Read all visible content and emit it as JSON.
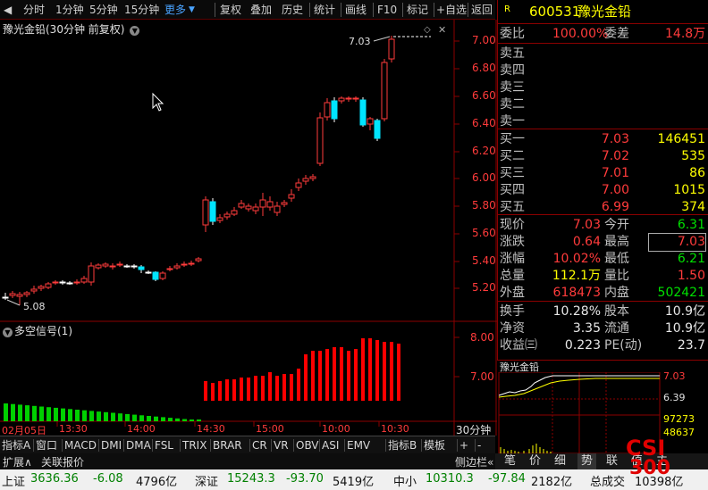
{
  "toolbar": {
    "period_tabs": [
      "分时",
      "1分钟",
      "5分钟",
      "15分钟"
    ],
    "more_label": "更多",
    "buttons": [
      "复权",
      "叠加",
      "历史",
      "统计",
      "画线",
      "F10",
      "标记",
      "+自选",
      "返回"
    ]
  },
  "chart": {
    "title": "豫光金铅(30分钟 前复权)",
    "price_axis": [
      "7.00",
      "6.80",
      "6.60",
      "6.40",
      "6.20",
      "6.00",
      "5.80",
      "5.60",
      "5.40",
      "5.20"
    ],
    "high_label": "7.03",
    "low_label": "5.08",
    "indicator_title": "多空信号(1)",
    "indicator_axis": [
      "8.00",
      "7.00"
    ],
    "time_labels": [
      "02月05日",
      "13:30",
      "14:00",
      "14:30",
      "15:00",
      "10:00",
      "10:30"
    ],
    "period_label": "30分钟"
  },
  "bottom_tabs": [
    "指标A",
    "窗口",
    "MACD",
    "DMI",
    "DMA",
    "FSL",
    "TRIX",
    "BRAR",
    "CR",
    "VR",
    "OBV",
    "ASI",
    "EMV",
    "指标B",
    "模板",
    "+",
    "-"
  ],
  "expand_bar": {
    "expand_label": "扩展∧",
    "related_label": "关联报价",
    "side_label": "侧边栏«"
  },
  "right_tabs": [
    "笔",
    "价",
    "细",
    "势",
    "联",
    "值",
    "主"
  ],
  "quote": {
    "marker": "R",
    "code": "600531",
    "name": "豫光金铅",
    "weibi_label": "委比",
    "weibi_value": "100.00%",
    "weicha_label": "委差",
    "weicha_value": "14.8万",
    "sells": [
      {
        "label": "卖五",
        "price": "",
        "vol": ""
      },
      {
        "label": "卖四",
        "price": "",
        "vol": ""
      },
      {
        "label": "卖三",
        "price": "",
        "vol": ""
      },
      {
        "label": "卖二",
        "price": "",
        "vol": ""
      },
      {
        "label": "卖一",
        "price": "",
        "vol": ""
      }
    ],
    "buys": [
      {
        "label": "买一",
        "price": "7.03",
        "vol": "146451"
      },
      {
        "label": "买二",
        "price": "7.02",
        "vol": "535"
      },
      {
        "label": "买三",
        "price": "7.01",
        "vol": "86"
      },
      {
        "label": "买四",
        "price": "7.00",
        "vol": "1015"
      },
      {
        "label": "买五",
        "price": "6.99",
        "vol": "374"
      }
    ],
    "stats": [
      {
        "l1": "现价",
        "v1": "7.03",
        "l2": "今开",
        "v2": "6.31"
      },
      {
        "l1": "涨跌",
        "v1": "0.64",
        "l2": "最高",
        "v2": "7.03"
      },
      {
        "l1": "涨幅",
        "v1": "10.02%",
        "l2": "最低",
        "v2": "6.21"
      },
      {
        "l1": "总量",
        "v1": "112.1万",
        "l2": "量比",
        "v2": "1.50"
      },
      {
        "l1": "外盘",
        "v1": "618473",
        "l2": "内盘",
        "v2": "502421"
      }
    ],
    "stats2": [
      {
        "l1": "换手",
        "v1": "10.28%",
        "l2": "股本",
        "v2": "10.9亿"
      },
      {
        "l1": "净资",
        "v1": "3.35",
        "l2": "流通",
        "v2": "10.9亿"
      },
      {
        "l1": "收益㈢",
        "v1": "0.223",
        "l2": "PE(动)",
        "v2": "23.7"
      }
    ],
    "mini_chart": {
      "name": "豫光金铅",
      "price_high": "7.03",
      "price_base": "6.39",
      "vol_high": "97273",
      "vol_mid": "48637"
    }
  },
  "status": {
    "items": [
      {
        "name": "上证",
        "value": "3636.36",
        "change": "-6.08",
        "amount": "4796亿"
      },
      {
        "name": "深证",
        "value": "15243.3",
        "change": "-93.70",
        "amount": "5419亿"
      },
      {
        "name": "中小",
        "value": "10310.3",
        "change": "-97.84",
        "amount": "2182亿"
      }
    ],
    "total_label": "总成交",
    "total_value": "10398亿"
  },
  "watermark": {
    "line1": "CSI",
    "line2": "300"
  },
  "colors": {
    "up": "#ff3b3b",
    "down": "#00e5ff",
    "grid": "#8b0000",
    "signal_up": "#ff0000",
    "signal_down": "#00d000"
  }
}
